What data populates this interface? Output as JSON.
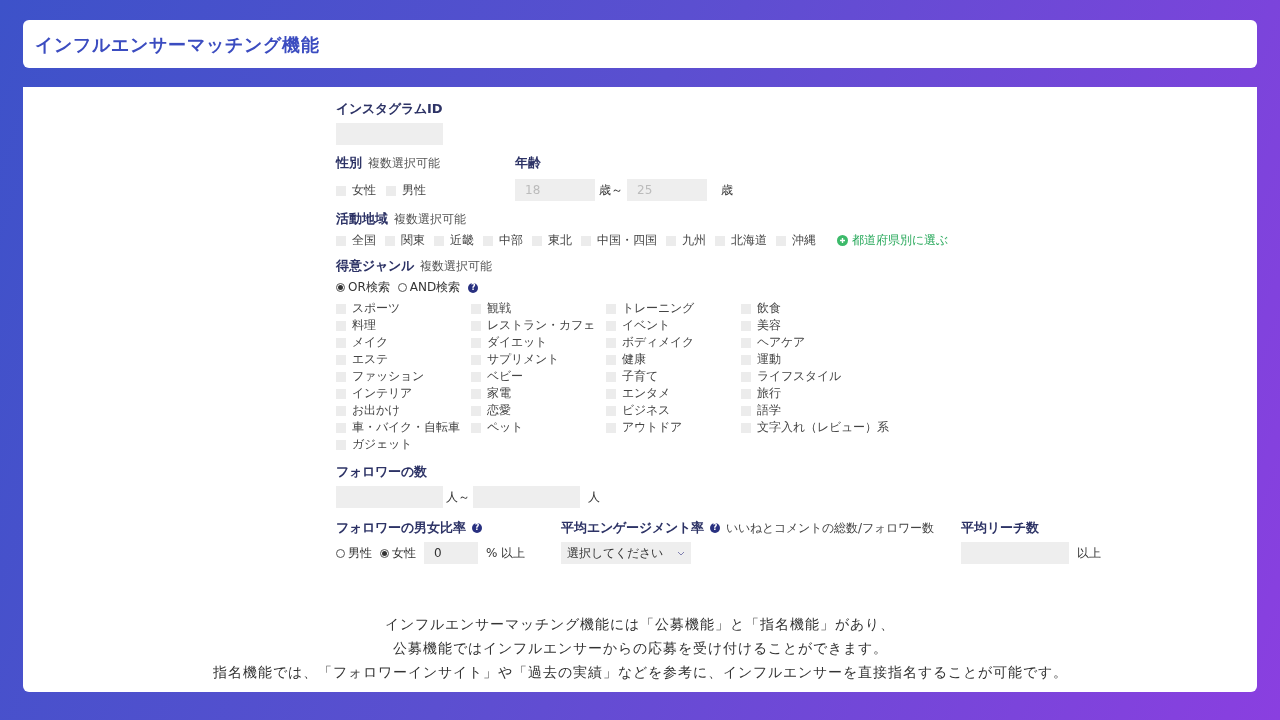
{
  "title": "インフルエンサーマッチング機能",
  "instagram_id": {
    "label": "インスタグラムID"
  },
  "gender": {
    "label": "性別",
    "note": "複数選択可能",
    "options": [
      {
        "label": "女性",
        "checked": false
      },
      {
        "label": "男性",
        "checked": false
      }
    ]
  },
  "age": {
    "label": "年齢",
    "min_placeholder": "18",
    "max_placeholder": "25",
    "unit_from": "歳～",
    "unit_to": "歳"
  },
  "region": {
    "label": "活動地域",
    "note": "複数選択可能",
    "options": [
      {
        "label": "全国",
        "checked": false
      },
      {
        "label": "関東",
        "checked": false
      },
      {
        "label": "近畿",
        "checked": false
      },
      {
        "label": "中部",
        "checked": false
      },
      {
        "label": "東北",
        "checked": false
      },
      {
        "label": "中国・四国",
        "checked": false
      },
      {
        "label": "九州",
        "checked": false
      },
      {
        "label": "北海道",
        "checked": false
      },
      {
        "label": "沖縄",
        "checked": false
      }
    ],
    "prefecture_link": "都道府県別に選ぶ"
  },
  "genre": {
    "label": "得意ジャンル",
    "note": "複数選択可能",
    "modes": [
      {
        "label": "OR検索",
        "selected": true
      },
      {
        "label": "AND検索",
        "selected": false
      }
    ],
    "help": "?",
    "options": [
      {
        "label": "スポーツ",
        "checked": false
      },
      {
        "label": "観戦",
        "checked": false
      },
      {
        "label": "トレーニング",
        "checked": false
      },
      {
        "label": "飲食",
        "checked": false
      },
      {
        "label": "料理",
        "checked": false
      },
      {
        "label": "レストラン・カフェ",
        "checked": false
      },
      {
        "label": "イベント",
        "checked": false
      },
      {
        "label": "美容",
        "checked": false
      },
      {
        "label": "メイク",
        "checked": false
      },
      {
        "label": "ダイエット",
        "checked": false
      },
      {
        "label": "ボディメイク",
        "checked": false
      },
      {
        "label": "ヘアケア",
        "checked": false
      },
      {
        "label": "エステ",
        "checked": false
      },
      {
        "label": "サプリメント",
        "checked": false
      },
      {
        "label": "健康",
        "checked": false
      },
      {
        "label": "運動",
        "checked": false
      },
      {
        "label": "ファッション",
        "checked": false
      },
      {
        "label": "ベビー",
        "checked": false
      },
      {
        "label": "子育て",
        "checked": false
      },
      {
        "label": "ライフスタイル",
        "checked": false
      },
      {
        "label": "インテリア",
        "checked": false
      },
      {
        "label": "家電",
        "checked": false
      },
      {
        "label": "エンタメ",
        "checked": false
      },
      {
        "label": "旅行",
        "checked": false
      },
      {
        "label": "お出かけ",
        "checked": false
      },
      {
        "label": "恋愛",
        "checked": false
      },
      {
        "label": "ビジネス",
        "checked": false
      },
      {
        "label": "語学",
        "checked": false
      },
      {
        "label": "車・バイク・自転車",
        "checked": false
      },
      {
        "label": "ペット",
        "checked": false
      },
      {
        "label": "アウトドア",
        "checked": false
      },
      {
        "label": "文字入れ（レビュー）系",
        "checked": false
      },
      {
        "label": "ガジェット",
        "checked": false
      }
    ]
  },
  "followers": {
    "label": "フォロワーの数",
    "unit_from": "人～",
    "unit_to": "人"
  },
  "follower_gender_ratio": {
    "label": "フォロワーの男女比率",
    "help": "?",
    "options": [
      {
        "label": "男性",
        "selected": false
      },
      {
        "label": "女性",
        "selected": true
      }
    ],
    "value": "0",
    "unit": "% 以上"
  },
  "engagement": {
    "label": "平均エンゲージメント率",
    "help": "?",
    "note": "いいねとコメントの総数/フォロワー数",
    "select_value": "選択してください"
  },
  "reach": {
    "label": "平均リーチ数",
    "unit": "以上"
  },
  "caption": [
    "インフルエンサーマッチング機能には「公募機能」と「指名機能」があり、",
    "公募機能ではインフルエンサーからの応募を受け付けることができます。",
    "指名機能では、「フォロワーインサイト」や「過去の実績」などを参考に、インフルエンサーを直接指名することが可能です。"
  ]
}
